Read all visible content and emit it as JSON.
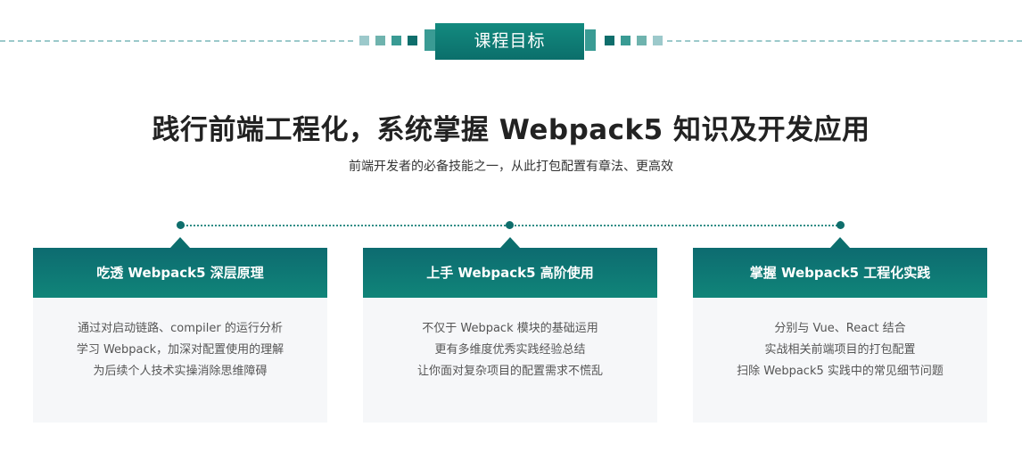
{
  "badge": {
    "label": "课程目标"
  },
  "headline": "践行前端工程化，系统掌握 Webpack5 知识及开发应用",
  "subheadline": "前端开发者的必备技能之一，从此打包配置有章法、更高效",
  "colors": {
    "brand_teal": "#0f6e6c",
    "accent_teal": "#3a9b94",
    "light_teal": "#9cc9cb",
    "card_bg": "#f6f7f9"
  },
  "cards": [
    {
      "title": "吃透 Webpack5 深层原理",
      "lines": [
        "通过对启动链路、compiler 的运行分析",
        "学习 Webpack，加深对配置使用的理解",
        "为后续个人技术实操消除思维障碍"
      ]
    },
    {
      "title": "上手 Webpack5 高阶使用",
      "lines": [
        "不仅于 Webpack 模块的基础运用",
        "更有多维度优秀实践经验总结",
        "让你面对复杂项目的配置需求不慌乱"
      ]
    },
    {
      "title": "掌握 Webpack5 工程化实践",
      "lines": [
        "分别与 Vue、React 结合",
        "实战相关前端项目的打包配置",
        "扫除 Webpack5 实践中的常见细节问题"
      ]
    }
  ]
}
